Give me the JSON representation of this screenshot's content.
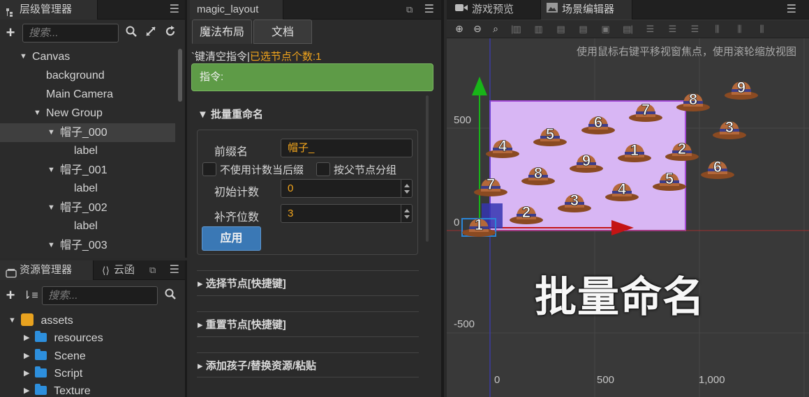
{
  "hierarchy": {
    "title": "层级管理器",
    "search_placeholder": "搜索...",
    "nodes": [
      {
        "label": "Canvas"
      },
      {
        "label": "background"
      },
      {
        "label": "Main Camera"
      },
      {
        "label": "New Group"
      },
      {
        "label": "帽子_000"
      },
      {
        "label": "label"
      },
      {
        "label": "帽子_001"
      },
      {
        "label": "label"
      },
      {
        "label": "帽子_002"
      },
      {
        "label": "label"
      },
      {
        "label": "帽子_003"
      }
    ]
  },
  "assets": {
    "tabs": [
      "资源管理器",
      "云函"
    ],
    "search_placeholder": "搜索...",
    "root": "assets",
    "folders": [
      "resources",
      "Scene",
      "Script",
      "Texture"
    ]
  },
  "magic": {
    "tab_title": "magic_layout",
    "subtabs": [
      "魔法布局",
      "文档"
    ],
    "cmd_prefix": "`键清空指令|",
    "cmd_highlight": "已选节点个数:1",
    "instruction": "指令:",
    "batch_rename": {
      "header": "▼ 批量重命名",
      "prefix_label": "前缀名",
      "prefix_value": "帽子_",
      "no_counter_label": "不使用计数当后缀",
      "group_by_parent_label": "按父节点分组",
      "start_label": "初始计数",
      "start_value": "0",
      "pad_label": "补齐位数",
      "pad_value": "3",
      "apply_label": "应用"
    },
    "sections": [
      "▸ 选择节点[快捷键]",
      "▸ 重置节点[快捷键]",
      "▸ 添加孩子/替换资源/粘贴"
    ]
  },
  "scene": {
    "tabs": [
      "游戏预览",
      "场景编辑器"
    ],
    "hint": "使用鼠标右键平移视窗焦点，使用滚轮缩放视图",
    "y_labels": [
      "500",
      "0",
      "-500"
    ],
    "x_labels": [
      "0",
      "500",
      "1,000"
    ],
    "caption": "批量命名",
    "hat_numbers": [
      "9",
      "8",
      "7",
      "6",
      "5",
      "4",
      "3",
      "2",
      "1",
      "9",
      "8",
      "7",
      "6",
      "5",
      "4",
      "3",
      "2",
      "1"
    ],
    "colors": {
      "selection_fill": "#d8b6f4",
      "selection_border": "#a44bd6",
      "y_axis": "#18b418",
      "x_axis": "#c41414"
    }
  }
}
